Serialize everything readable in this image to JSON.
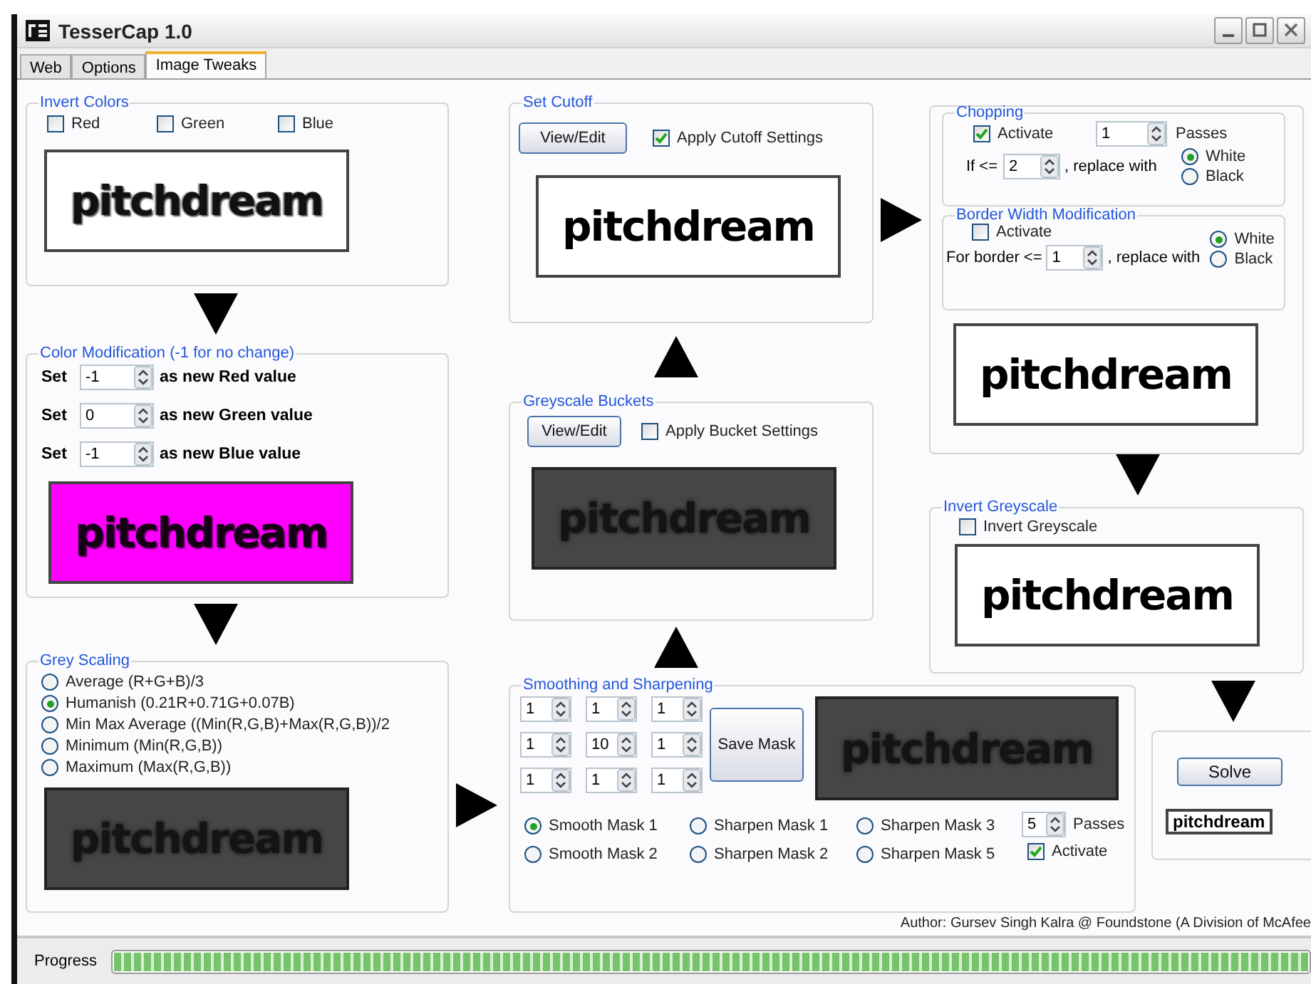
{
  "window": {
    "title": "TesserCap 1.0"
  },
  "tabs": [
    {
      "label": "Web",
      "selected": false
    },
    {
      "label": "Options",
      "selected": false
    },
    {
      "label": "Image Tweaks",
      "selected": true
    }
  ],
  "invert_colors": {
    "title": "Invert Colors",
    "options": [
      {
        "label": "Red",
        "checked": false
      },
      {
        "label": "Green",
        "checked": false
      },
      {
        "label": "Blue",
        "checked": false
      }
    ],
    "preview": {
      "kind": "noisy",
      "text": "pitchdream"
    }
  },
  "color_modification": {
    "title": "Color Modification (-1 for no change)",
    "rows": [
      {
        "prefix": "Set",
        "value": "-1",
        "suffix": "as new Red value"
      },
      {
        "prefix": "Set",
        "value": "0",
        "suffix": "as new Green value"
      },
      {
        "prefix": "Set",
        "value": "-1",
        "suffix": "as new Blue value"
      }
    ],
    "preview": {
      "kind": "magenta",
      "text": "pitchdream"
    }
  },
  "grey_scaling": {
    "title": "Grey Scaling",
    "options": [
      {
        "label": "Average (R+G+B)/3",
        "selected": false
      },
      {
        "label": "Humanish (0.21R+0.71G+0.07B)",
        "selected": true
      },
      {
        "label": "Min Max Average ((Min(R,G,B)+Max(R,G,B))/2",
        "selected": false
      },
      {
        "label": "Minimum (Min(R,G,B))",
        "selected": false
      },
      {
        "label": "Maximum (Max(R,G,B))",
        "selected": false
      }
    ],
    "preview": {
      "kind": "dark",
      "text": "pitchdream"
    }
  },
  "set_cutoff": {
    "title": "Set Cutoff",
    "button": "View/Edit",
    "checkbox": {
      "label": "Apply Cutoff Settings",
      "checked": true
    },
    "preview": {
      "kind": "clean",
      "text": "pitchdream"
    }
  },
  "greyscale_buckets": {
    "title": "Greyscale Buckets",
    "button": "View/Edit",
    "checkbox": {
      "label": "Apply Bucket Settings",
      "checked": false
    },
    "preview": {
      "kind": "dark",
      "text": "pitchdream"
    }
  },
  "smoothing": {
    "title": "Smoothing and Sharpening",
    "mask": [
      [
        "1",
        "1",
        "1"
      ],
      [
        "1",
        "10",
        "1"
      ],
      [
        "1",
        "1",
        "1"
      ]
    ],
    "save_button": "Save Mask",
    "preview": {
      "kind": "dark",
      "text": "pitchdream"
    },
    "masks": [
      {
        "label": "Smooth Mask 1",
        "selected": true
      },
      {
        "label": "Sharpen Mask 1",
        "selected": false
      },
      {
        "label": "Sharpen Mask 3",
        "selected": false
      },
      {
        "label": "Smooth Mask 2",
        "selected": false
      },
      {
        "label": "Sharpen Mask 2",
        "selected": false
      },
      {
        "label": "Sharpen Mask 5",
        "selected": false
      }
    ],
    "passes": {
      "value": "5",
      "label": "Passes"
    },
    "activate": {
      "label": "Activate",
      "checked": true
    }
  },
  "chopping": {
    "title": "Chopping",
    "activate": {
      "label": "Activate",
      "checked": true
    },
    "passes": {
      "value": "1",
      "label": "Passes"
    },
    "threshold": {
      "prefix": "If <=",
      "value": "2",
      "suffix": ", replace with"
    },
    "replace": [
      {
        "label": "White",
        "selected": true
      },
      {
        "label": "Black",
        "selected": false
      }
    ]
  },
  "border_width": {
    "title": "Border Width Modification",
    "activate": {
      "label": "Activate",
      "checked": false
    },
    "threshold": {
      "prefix": "For border <=",
      "value": "1",
      "suffix": ", replace with"
    },
    "replace": [
      {
        "label": "White",
        "selected": true
      },
      {
        "label": "Black",
        "selected": false
      }
    ],
    "preview": {
      "kind": "clean",
      "text": "pitchdream"
    }
  },
  "invert_greyscale": {
    "title": "Invert Greyscale",
    "checkbox": {
      "label": "Invert Greyscale",
      "checked": false
    },
    "preview": {
      "kind": "clean",
      "text": "pitchdream"
    }
  },
  "solve": {
    "button": "Solve",
    "result": "pitchdream"
  },
  "author": "Author: Gursev Singh Kalra @ Foundstone (A Division of McAfee",
  "progress": {
    "label": "Progress",
    "level": 1
  }
}
